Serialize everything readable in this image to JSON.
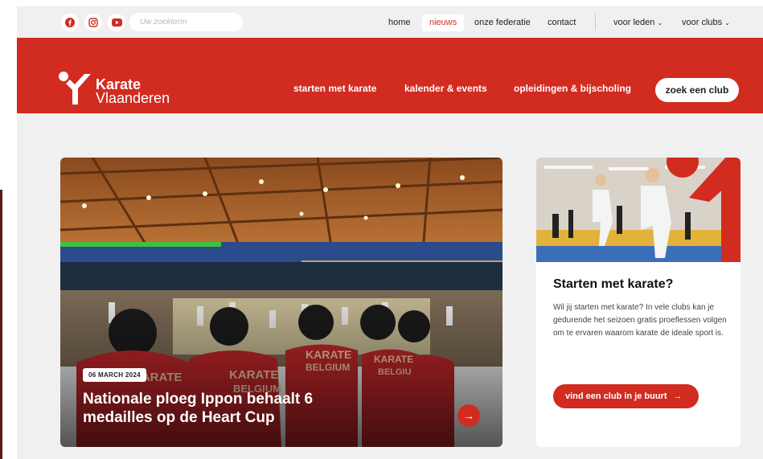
{
  "topbar": {
    "social": [
      {
        "name": "facebook",
        "icon": "facebook-icon"
      },
      {
        "name": "instagram",
        "icon": "instagram-icon"
      },
      {
        "name": "youtube",
        "icon": "youtube-icon"
      }
    ],
    "search_placeholder": "Uw zoekterm",
    "nav": {
      "home": "home",
      "nieuws": "nieuws",
      "federatie": "onze federatie",
      "contact": "contact",
      "leden": "voor leden",
      "clubs": "voor clubs"
    }
  },
  "header": {
    "logo_line1": "Karate",
    "logo_line2": "Vlaanderen",
    "nav": {
      "starten": "starten met karate",
      "kalender": "kalender & events",
      "opleidingen": "opleidingen & bijscholing"
    },
    "cta": "zoek een club"
  },
  "hero": {
    "date": "06 MARCH 2024",
    "title": "Nationale ploeg Ippon behaalt 6 medailles op de Heart Cup",
    "jersey_text": "KARATE BELGIUM",
    "arrow": "→"
  },
  "card": {
    "title": "Starten met karate?",
    "text": "Wil jij starten met karate? In vele clubs kan je gedurende het seizoen gratis proeflessen volgen om te ervaren waarom karate de ideale sport is.",
    "button": "vind een club in je buurt",
    "arrow": "→"
  },
  "colors": {
    "brand_red": "#d22b20",
    "topbar_bg": "#f0f0f0",
    "content_bg": "#f0f0f0"
  }
}
